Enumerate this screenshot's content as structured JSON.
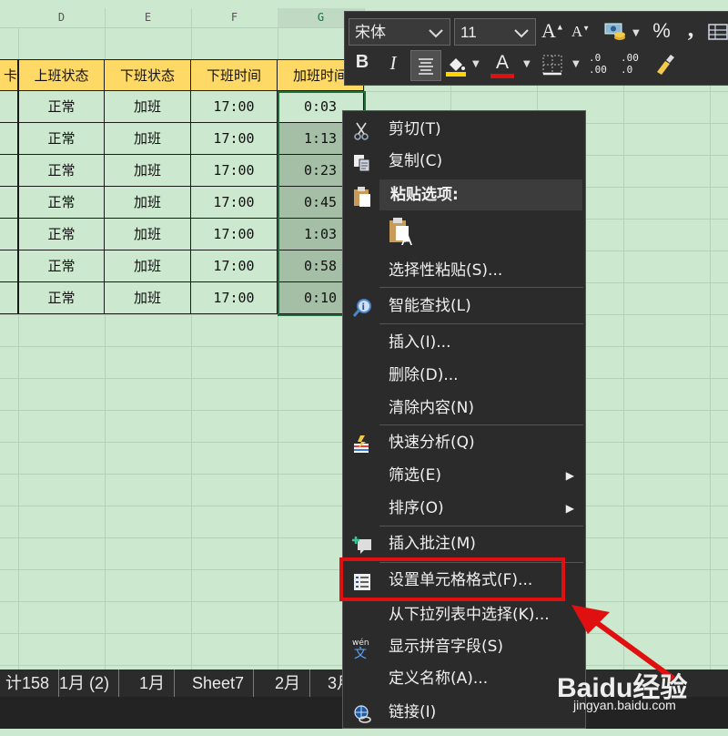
{
  "columns": [
    {
      "letter": "D",
      "selected": false
    },
    {
      "letter": "E",
      "selected": false
    },
    {
      "letter": "F",
      "selected": false
    },
    {
      "letter": "G",
      "selected": true
    }
  ],
  "table": {
    "partial_header": "卡",
    "headers": [
      "上班状态",
      "下班状态",
      "下班时间",
      "加班时间"
    ],
    "rows": [
      [
        "正常",
        "加班",
        "17:00",
        "0:03"
      ],
      [
        "正常",
        "加班",
        "17:00",
        "1:13"
      ],
      [
        "正常",
        "加班",
        "17:00",
        "0:23"
      ],
      [
        "正常",
        "加班",
        "17:00",
        "0:45"
      ],
      [
        "正常",
        "加班",
        "17:00",
        "1:03"
      ],
      [
        "正常",
        "加班",
        "17:00",
        "0:58"
      ],
      [
        "正常",
        "加班",
        "17:00",
        "0:10"
      ]
    ]
  },
  "sheet_tabs": [
    "计158",
    "1月 (2)",
    "1月",
    "Sheet7",
    "2月",
    "3月"
  ],
  "mini_toolbar": {
    "font_name": "宋体",
    "font_size": "11",
    "grow_font": "A",
    "shrink_font": "A",
    "percent": "%",
    "comma": ",",
    "bold": "B",
    "italic": "I",
    "font_color_letter": "A",
    "increase_decimal": ".0\n.00",
    "decrease_decimal": ".00\n.0"
  },
  "context_menu": {
    "items": [
      {
        "label": "剪切(T)",
        "icon": "scissors-icon"
      },
      {
        "label": "复制(C)",
        "icon": "copy-icon"
      },
      {
        "label": "粘贴选项:",
        "icon": "paste-icon",
        "header": true
      },
      {
        "label": "",
        "icon": "paste-keep-text-icon"
      },
      {
        "label": "选择性粘贴(S)...",
        "icon": ""
      },
      {
        "label": "智能查找(L)",
        "icon": "smart-lookup-icon"
      },
      {
        "label": "插入(I)...",
        "icon": ""
      },
      {
        "label": "删除(D)...",
        "icon": ""
      },
      {
        "label": "清除内容(N)",
        "icon": ""
      },
      {
        "label": "快速分析(Q)",
        "icon": "quick-analysis-icon"
      },
      {
        "label": "筛选(E)",
        "icon": "",
        "submenu": true
      },
      {
        "label": "排序(O)",
        "icon": "",
        "submenu": true
      },
      {
        "label": "插入批注(M)",
        "icon": "insert-comment-icon"
      },
      {
        "label": "设置单元格格式(F)...",
        "icon": "format-cells-icon",
        "highlighted": true
      },
      {
        "label": "从下拉列表中选择(K)...",
        "icon": ""
      },
      {
        "label": "显示拼音字段(S)",
        "icon": "phonetic-icon"
      },
      {
        "label": "定义名称(A)...",
        "icon": ""
      },
      {
        "label": "链接(I)",
        "icon": "link-icon"
      }
    ]
  },
  "watermark": {
    "brand": "Baidu经验",
    "url": "jingyan.baidu.com"
  },
  "colors": {
    "sheet_bg": "#cce8cf",
    "header_fill": "#ffd966",
    "menu_bg": "#2b2b2b",
    "highlight_red": "#e01010"
  }
}
